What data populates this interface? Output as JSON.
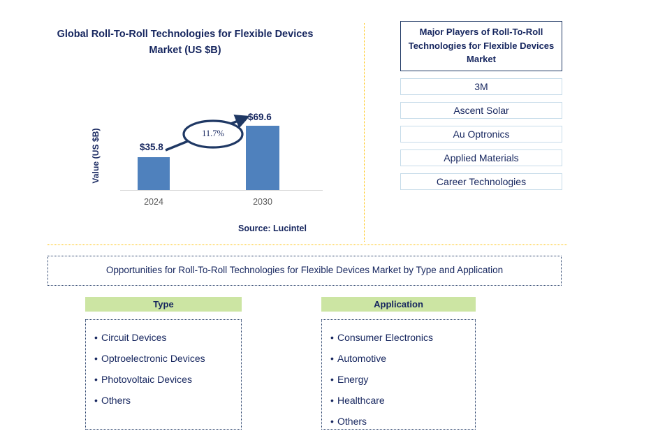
{
  "chart_panel": {
    "title": "Global Roll-To-Roll Technologies for Flexible Devices Market (US $B)",
    "ylabel": "Value (US $B)",
    "cagr_label": "11.7%",
    "source": "Source: Lucintel"
  },
  "chart_data": {
    "type": "bar",
    "title": "Global Roll-To-Roll Technologies for Flexible Devices Market (US $B)",
    "categories": [
      "2024",
      "2030"
    ],
    "values": [
      35.8,
      69.6
    ],
    "data_labels": [
      "$35.8",
      "$69.6"
    ],
    "xlabel": "",
    "ylabel": "Value (US $B)",
    "ylim": [
      0,
      80
    ],
    "grid": false,
    "legend": "none",
    "bar_color": "#4f81bd",
    "annotation": {
      "text": "11.7%",
      "kind": "cagr-arrow-ellipse",
      "from_category": "2024",
      "to_category": "2030"
    },
    "source": "Source: Lucintel"
  },
  "players": {
    "header": "Major Players of Roll-To-Roll Technologies for Flexible Devices Market",
    "items": [
      "3M",
      "Ascent Solar",
      "Au Optronics",
      "Applied Materials",
      "Career Technologies"
    ]
  },
  "opportunities": {
    "banner": "Opportunities for Roll-To-Roll Technologies for Flexible Devices Market by Type and Application",
    "columns": [
      {
        "header": "Type",
        "items": [
          "Circuit Devices",
          "Optroelectronic Devices",
          "Photovoltaic Devices",
          "Others"
        ]
      },
      {
        "header": "Application",
        "items": [
          "Consumer Electronics",
          "Automotive",
          "Energy",
          "Healthcare",
          "Others"
        ]
      }
    ]
  },
  "colors": {
    "navy_text": "#15255e",
    "bar_blue": "#4f81bd",
    "divider_gold": "#ffc000",
    "header_green": "#cce5a3",
    "player_border": "#c6dbe9"
  }
}
